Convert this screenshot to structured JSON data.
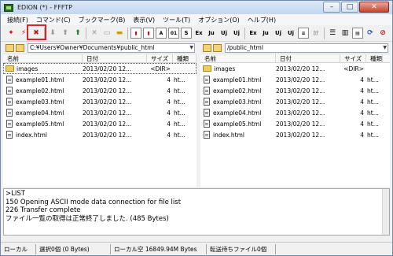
{
  "window": {
    "title": "EDION (*) - FFFTP"
  },
  "menubar": {
    "items": [
      "接続(F)",
      "コマンド(C)",
      "ブックマーク(B)",
      "表示(V)",
      "ツール(T)",
      "オプション(O)",
      "ヘルプ(H)"
    ]
  },
  "toolbar": {
    "mode_labels": [
      "S",
      "Ex",
      "Ju",
      "Uj",
      "Uj",
      "Ex",
      "Ju",
      "Uj",
      "Uj",
      "ｶﾅ"
    ]
  },
  "local_pane": {
    "path": "C:¥Users¥Owner¥Documents¥public_html",
    "columns": [
      "名前",
      "日付",
      "サイズ",
      "種類"
    ],
    "rows": [
      {
        "name": "images",
        "date": "2013/02/20 12...",
        "size": "<DIR>",
        "type": "",
        "kind": "folder"
      },
      {
        "name": "example01.html",
        "date": "2013/02/20 12...",
        "size": "4",
        "type": "ht...",
        "kind": "file"
      },
      {
        "name": "example02.html",
        "date": "2013/02/20 12...",
        "size": "4",
        "type": "ht...",
        "kind": "file"
      },
      {
        "name": "example03.html",
        "date": "2013/02/20 12...",
        "size": "4",
        "type": "ht...",
        "kind": "file"
      },
      {
        "name": "example04.html",
        "date": "2013/02/20 12...",
        "size": "4",
        "type": "ht...",
        "kind": "file"
      },
      {
        "name": "example05.html",
        "date": "2013/02/20 12...",
        "size": "4",
        "type": "ht...",
        "kind": "file"
      },
      {
        "name": "index.html",
        "date": "2013/02/20 12...",
        "size": "4",
        "type": "ht...",
        "kind": "file"
      }
    ]
  },
  "remote_pane": {
    "path": "/public_html",
    "columns": [
      "名前",
      "日付",
      "サイズ",
      "種類"
    ],
    "rows": [
      {
        "name": "images",
        "date": "2013/02/20 12...",
        "size": "<DIR>",
        "type": "",
        "kind": "folder"
      },
      {
        "name": "example01.html",
        "date": "2013/02/20 12...",
        "size": "4",
        "type": "ht...",
        "kind": "file"
      },
      {
        "name": "example02.html",
        "date": "2013/02/20 12...",
        "size": "4",
        "type": "ht...",
        "kind": "file"
      },
      {
        "name": "example03.html",
        "date": "2013/02/20 12...",
        "size": "4",
        "type": "ht...",
        "kind": "file"
      },
      {
        "name": "example04.html",
        "date": "2013/02/20 12...",
        "size": "4",
        "type": "ht...",
        "kind": "file"
      },
      {
        "name": "example05.html",
        "date": "2013/02/20 12...",
        "size": "4",
        "type": "ht...",
        "kind": "file"
      },
      {
        "name": "index.html",
        "date": "2013/02/20 12...",
        "size": "4",
        "type": "ht...",
        "kind": "file"
      }
    ]
  },
  "log": {
    "lines": [
      ">LIST",
      "150 Opening ASCII mode data connection for file list",
      "226 Transfer complete",
      "ファイル一覧の取得は正常終了しました. (485 Bytes)"
    ]
  },
  "statusbar": {
    "segments": [
      "ローカル",
      "選択0個 (0 Bytes)",
      "ローカル空 16849.94M Bytes",
      "転送待ちファイル0個"
    ]
  },
  "colors": {
    "highlight": "#d8232a",
    "title_gradient_top": "#dbe8f6"
  }
}
